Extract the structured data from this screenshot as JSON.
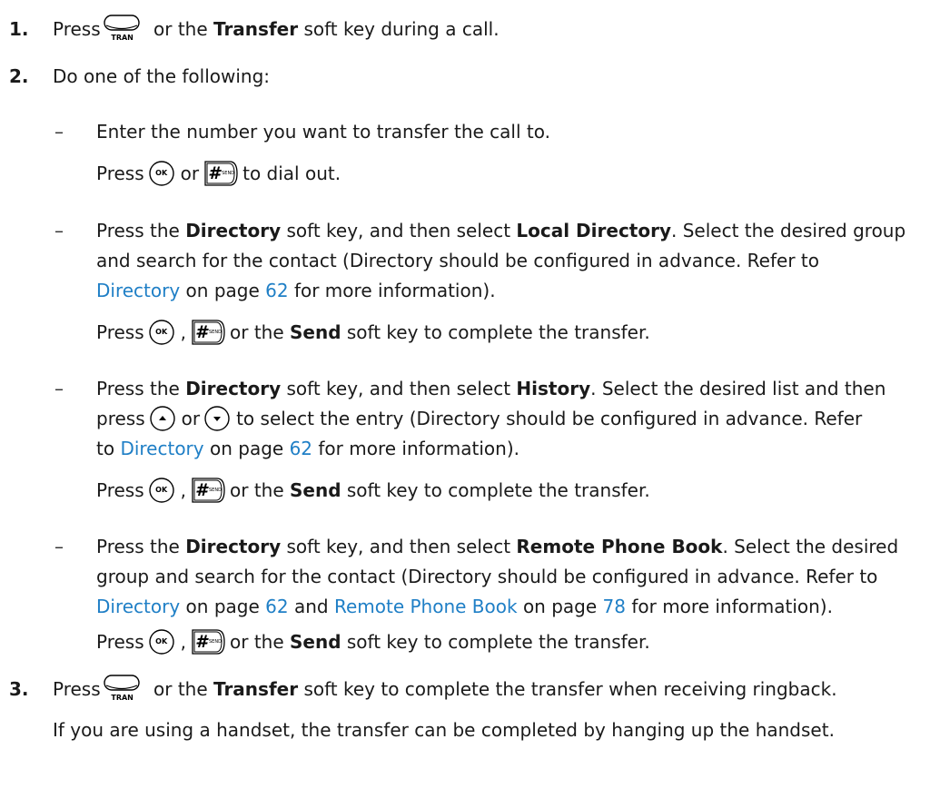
{
  "steps": {
    "s1": {
      "num": "1.",
      "pre": "Press",
      "mid": "or the",
      "key": "Transfer",
      "post": "soft key during a call."
    },
    "s2": {
      "num": "2.",
      "text": "Do one of the following:"
    },
    "s3": {
      "num": "3.",
      "pre": "Press",
      "mid": "or the",
      "key": "Transfer",
      "post": "soft key to complete the transfer when receiving ringback.",
      "note": "If you are using a handset, the transfer can be completed by hanging up the handset."
    }
  },
  "options": {
    "dash": "–",
    "o1": {
      "line1": "Enter the number you want to transfer the call to.",
      "press": "Press",
      "or": "or",
      "post": "to dial out."
    },
    "o2": {
      "a": "Press the",
      "b": "Directory",
      "c": "soft key, and then select",
      "d": "Local Directory",
      "e": ". Select the desired group",
      "line2": "and search for the contact (Directory should be configured in advance. Refer to",
      "link": "Directory",
      "onpage": "on page",
      "page": "62",
      "tail": "for more information).",
      "press": "Press",
      "comma": ",",
      "orthe": "or the",
      "send": "Send",
      "complete": "soft key to complete the transfer."
    },
    "o3": {
      "a": "Press the",
      "b": "Directory",
      "c": "soft key, and then select",
      "d": "History",
      "e": ". Select the desired list and then",
      "press": "press",
      "or": "or",
      "f": "to select the entry (Directory should be configured in advance. Refer",
      "to": "to",
      "link": "Directory",
      "onpage": "on page",
      "page": "62",
      "tail": "for more information).",
      "press2": "Press",
      "comma": ",",
      "orthe": "or the",
      "send": "Send",
      "complete": "soft key to complete the transfer."
    },
    "o4": {
      "a": "Press the",
      "b": "Directory",
      "c": "soft key, and then select",
      "d": "Remote Phone Book",
      "e": ". Select the desired",
      "line2": "group and search for the contact (Directory should be configured in advance. Refer to",
      "link1": "Directory",
      "onpage1": "on page",
      "page1": "62",
      "and": "and",
      "link2": "Remote Phone Book",
      "onpage2": "on page",
      "page2": "78",
      "tail": "for more information).",
      "press": "Press",
      "comma": ",",
      "orthe": "or the",
      "send": "Send",
      "complete": "soft key to complete the transfer."
    }
  },
  "keys": {
    "tran": "TRAN",
    "ok": "OK",
    "hash": "#",
    "send_small": "SEND"
  },
  "colors": {
    "link": "#1f7fc6",
    "text": "#1a1a1a"
  },
  "icons": [
    "tran-key-icon",
    "ok-key-icon",
    "send-key-icon",
    "up-arrow-key-icon",
    "down-arrow-key-icon"
  ]
}
